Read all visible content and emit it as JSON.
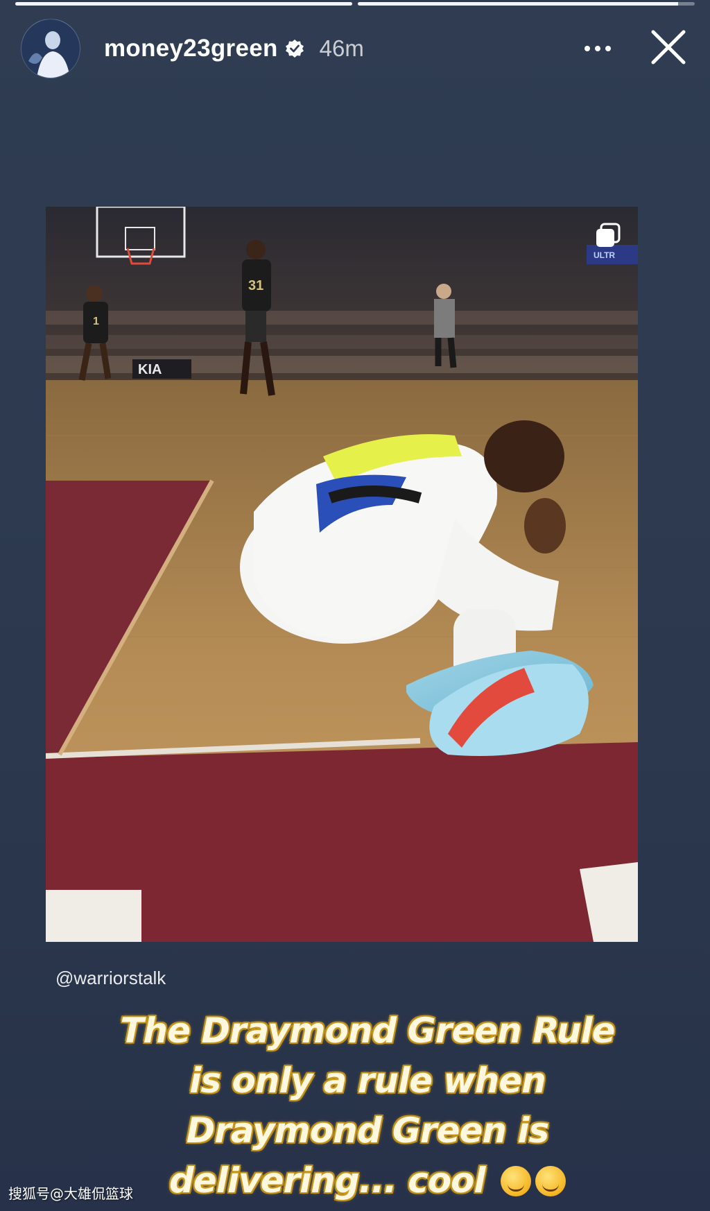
{
  "story": {
    "progress": [
      1.0,
      0.95
    ],
    "username": "money23green",
    "verified": true,
    "time": "46m",
    "more_icon": "more-horizontal-icon",
    "close_icon": "close-icon"
  },
  "post": {
    "multi_icon": "carousel-icon",
    "photo_desc_icon": "basketball-player-on-floor",
    "jersey_number": "31",
    "player_number": "1",
    "sponsor": "KIA",
    "handle": "@warriorstalk"
  },
  "caption": {
    "text": "The Draymond Green Rule is only a rule when Draymond Green is delivering... cool",
    "emoji": "smiling-face-emoji"
  },
  "watermark": "搜狐号@大雄侃篮球",
  "colors": {
    "background": "#2d3a50",
    "caption_glow": "#e0b12d"
  }
}
